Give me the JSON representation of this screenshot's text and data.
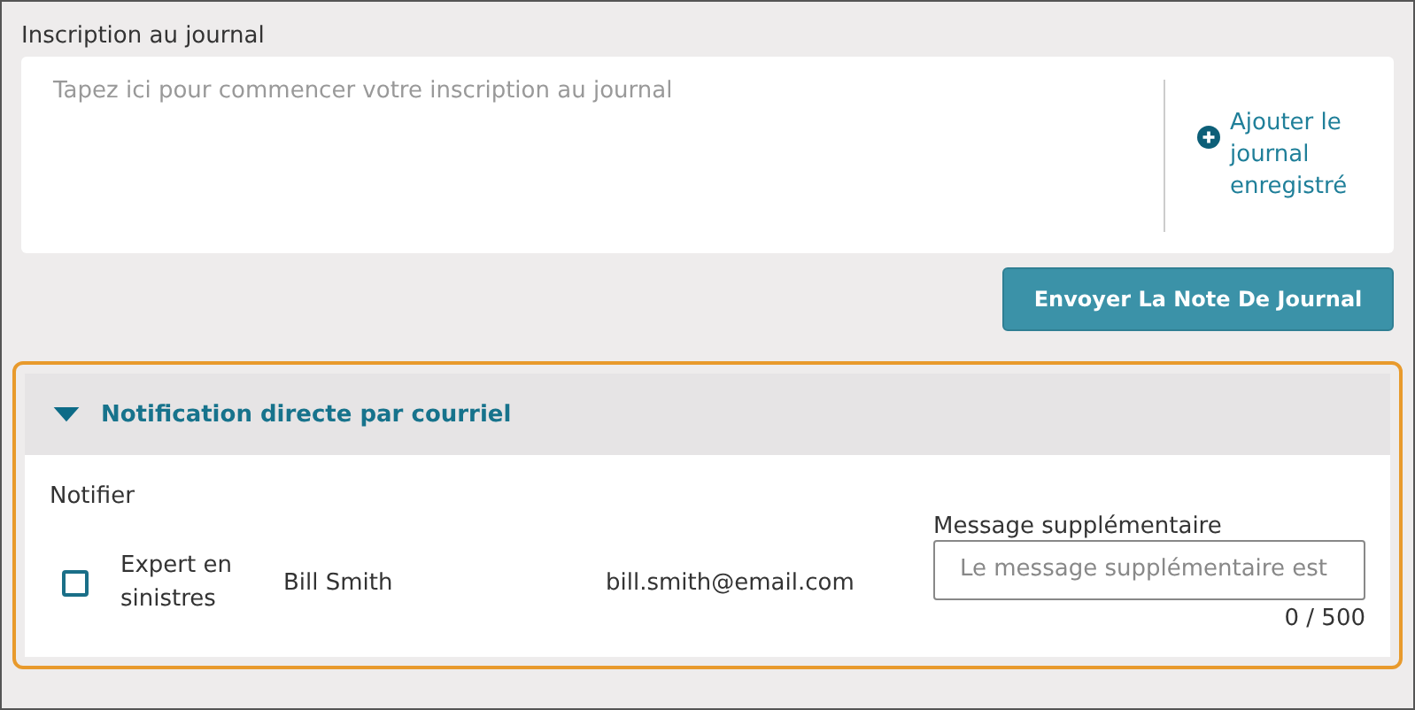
{
  "journal": {
    "label": "Inscription au journal",
    "placeholder": "Tapez ici pour commencer votre inscription au journal",
    "add_link": "Ajouter le journal enregistré",
    "submit_button": "Envoyer La Note De Journal"
  },
  "notification": {
    "title": "Notification directe par courriel",
    "expanded": true,
    "notify_label": "Notifier",
    "recipients": [
      {
        "role": "Expert en sinistres",
        "name": "Bill Smith",
        "email": "bill.smith@email.com",
        "checked": false
      }
    ],
    "message": {
      "label": "Message supplémentaire",
      "placeholder": "Le message supplémentaire est",
      "counter": "0 / 500"
    }
  }
}
